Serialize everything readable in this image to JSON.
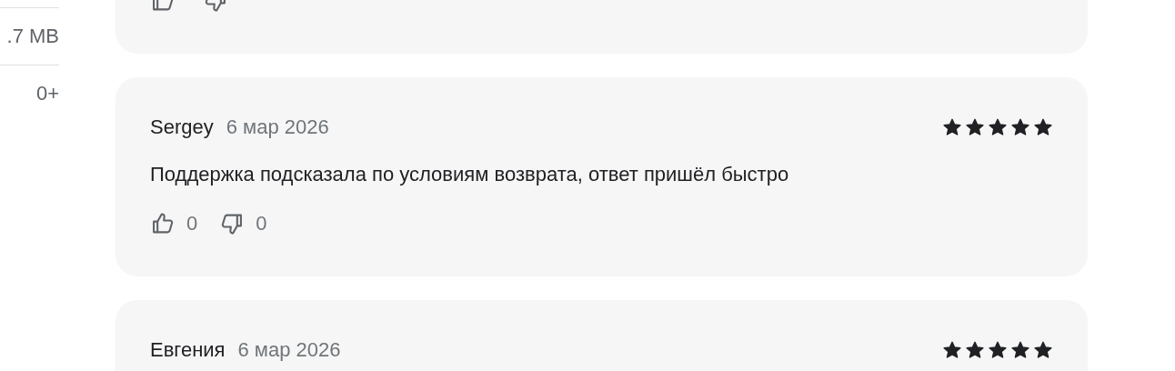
{
  "app_info": [
    {
      "value": ".7 MB"
    },
    {
      "value": "0+"
    }
  ],
  "reviews": [
    {
      "vote_buttons": true
    },
    {
      "author": "Sergey",
      "date": "6 мар 2026",
      "stars": 5,
      "text": "Поддержка подсказала по условиям возврата, ответ пришёл быстро",
      "vote_buttons": true,
      "likes": "0",
      "dislikes": "0"
    },
    {
      "author": "Евгения",
      "date": "6 мар 2026",
      "stars": 5
    }
  ]
}
